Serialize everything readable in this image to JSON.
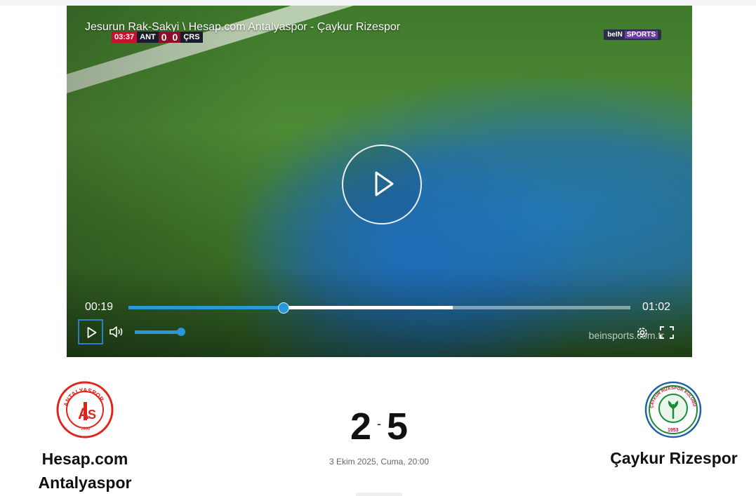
{
  "video": {
    "title": "Jesurun Rak-Sakyi \\ Hesap.com Antalyaspor - Çaykur Rizespor",
    "scorebug": {
      "clock": "03:37",
      "home": "ANT",
      "home_score": "0",
      "away_score": "0",
      "away": "ÇRS"
    },
    "broadcaster": {
      "brand": "beIN",
      "sub": "SPORTS"
    },
    "watermark": "beinsports.com.tr",
    "current_time": "00:19",
    "duration": "01:02",
    "played_fraction": 0.307,
    "buffered_fraction": 0.646,
    "volume_fraction": 1.0,
    "icons": [
      "play-icon",
      "volume-icon",
      "settings-icon",
      "fullscreen-icon"
    ]
  },
  "match": {
    "home_team": "Hesap.com Antalyaspor",
    "away_team": "Çaykur Rizespor",
    "home_score": "2",
    "separator": "-",
    "away_score": "5",
    "date": "3 Ekim 2025, Cuma, 20:00",
    "home_logo_text": "ANTALYASPOR",
    "away_logo_text": "ÇAYKUR RİZESPOR KULÜBÜ 1953"
  },
  "colors": {
    "accent": "#2a97d6",
    "antalya_red": "#e2231a",
    "rize_green": "#1a8a3a",
    "rize_blue": "#1d5fa8"
  }
}
